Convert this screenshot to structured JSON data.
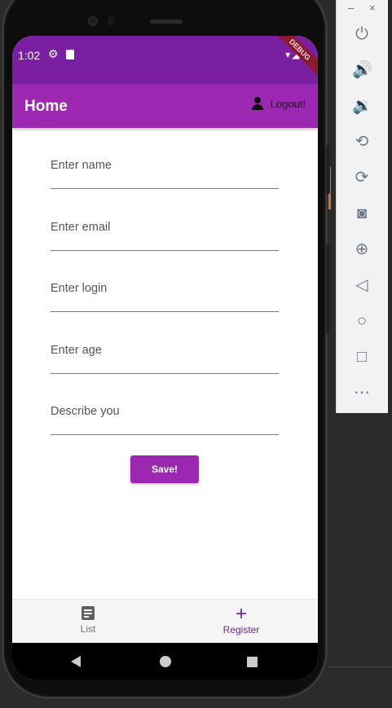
{
  "status_bar": {
    "time": "1:02",
    "debug_ribbon": "DEBUG"
  },
  "app_bar": {
    "title": "Home",
    "logout_label": "Logout!"
  },
  "form": {
    "fields": [
      {
        "placeholder": "Enter name"
      },
      {
        "placeholder": "Enter email"
      },
      {
        "placeholder": "Enter login"
      },
      {
        "placeholder": "Enter age"
      },
      {
        "placeholder": "Describe you"
      }
    ],
    "save_label": "Save!"
  },
  "bottom_nav": {
    "items": [
      {
        "label": "List",
        "icon": "list-icon",
        "selected": false
      },
      {
        "label": "Register",
        "icon": "plus-icon",
        "selected": true
      }
    ]
  },
  "emulator_toolbar": {
    "minimize": "–",
    "close": "×",
    "icons": [
      "power-icon",
      "volume-up-icon",
      "volume-down-icon",
      "rotate-left-icon",
      "rotate-right-icon",
      "screenshot-icon",
      "zoom-icon",
      "back-icon",
      "home-icon",
      "overview-icon",
      "more-icon"
    ]
  },
  "colors": {
    "primary": "#9c27b0",
    "primary_dark": "#7b1fa2"
  }
}
